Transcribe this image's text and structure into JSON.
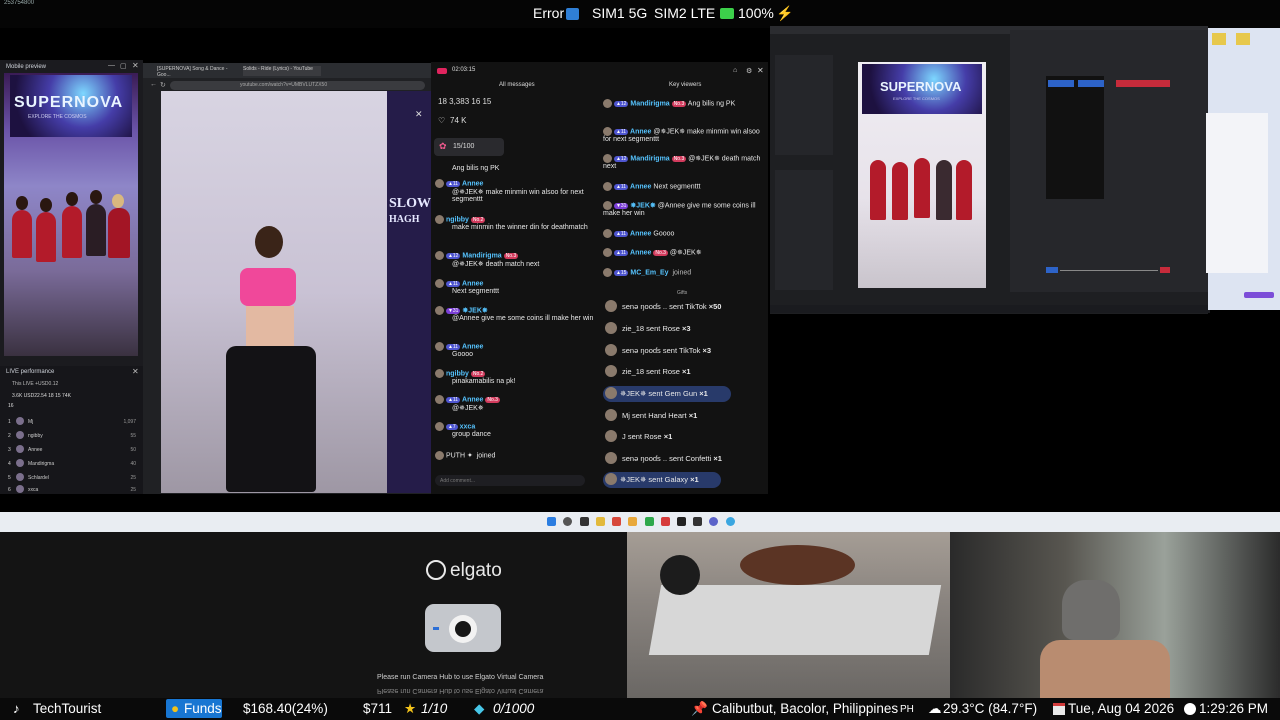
{
  "statusbar": {
    "error": "Error",
    "sim1": "SIM1 5G",
    "sim2": "SIM2 LTE",
    "battery": "100%",
    "corner_id": "253754800"
  },
  "mobile_preview": {
    "title": "Mobile preview",
    "banner_title": "SUPERNOVA",
    "banner_sub": "EXPLORE THE COSMOS"
  },
  "live_performance": {
    "title": "LIVE performance",
    "subtitle": "This LIVE +USD0.12",
    "stats": "3.6K  USD22.54  18  15  74K",
    "count": "16",
    "rows": [
      {
        "rank": "1",
        "name": "Mj",
        "score": "1,097"
      },
      {
        "rank": "2",
        "name": "ngibby",
        "score": "55"
      },
      {
        "rank": "3",
        "name": "Annee",
        "score": "50"
      },
      {
        "rank": "4",
        "name": "Mandirigma",
        "score": "40"
      },
      {
        "rank": "5",
        "name": "Schlardel",
        "score": "25"
      },
      {
        "rank": "6",
        "name": "xxca",
        "score": "25"
      }
    ]
  },
  "browser": {
    "tab1": "[SUPERNOVA] Song & Dance - Goo...",
    "tab2": "Solids - Ride (Lyrics) - YouTube",
    "url": "youtube.com/watch?v=UMBVLUTZX50",
    "strip_text_1": "SLOW",
    "strip_text_2": "HAGH"
  },
  "chat": {
    "timer": "02:03:15",
    "all_messages": "All messages",
    "key_viewers": "Key viewers",
    "stats": "18   3,383   16   15",
    "likes": "74 K",
    "goal": "15/100",
    "messages": [
      {
        "name": "",
        "text": "Ang bilis ng PK"
      },
      {
        "name": "Annee",
        "text": "@✵JEK✵ make minmin win alsoo for next segmenttt"
      },
      {
        "name": "ngibby",
        "text": "make minmin the winner din for deathmatch"
      },
      {
        "name": "Mandirigma",
        "text": "@✵JEK✵ death match next"
      },
      {
        "name": "Annee",
        "text": "Next segmenttt"
      },
      {
        "name": "✵JEK✵",
        "text": "@Annee give me some coins ill make her win"
      },
      {
        "name": "Annee",
        "text": "Goooo"
      },
      {
        "name": "ngibby",
        "text": "pinakamabilis na pk!"
      },
      {
        "name": "Annee",
        "text": "@✵JEK✵"
      },
      {
        "name": "xxca",
        "text": "group dance"
      },
      {
        "name": "PUTH",
        "text": "joined"
      }
    ],
    "input_placeholder": "Add comment...",
    "key_messages": [
      {
        "name": "Mandirigma",
        "text": "Ang bilis ng PK"
      },
      {
        "name": "Annee",
        "text": "@✵JEK✵ make minmin win alsoo for next segmenttt"
      },
      {
        "name": "Mandirigma",
        "text": "@✵JEK✵ death match next"
      },
      {
        "name": "Annee",
        "text": "Next segmenttt"
      },
      {
        "name": "✵JEK✵",
        "text": "@Annee give me some coins ill make her win"
      },
      {
        "name": "Annee",
        "text": "Goooo"
      },
      {
        "name": "Annee",
        "text": "@✵JEK✵"
      },
      {
        "name": "MC_Em_Ey",
        "text": "joined"
      }
    ],
    "gifts_label": "Gifts",
    "gifts": [
      {
        "text": "senə ŋooɗs .. sent TikTok",
        "count": "×50"
      },
      {
        "text": "zie_18 sent Rose",
        "count": "×3"
      },
      {
        "text": "senə ŋooɗs sent TikTok",
        "count": "×3"
      },
      {
        "text": "zie_18 sent Rose",
        "count": "×1"
      },
      {
        "text": "✵JEK✵ sent Gem Gun",
        "count": "×1"
      },
      {
        "text": "Mj sent Hand Heart",
        "count": "×1"
      },
      {
        "text": "J sent Rose",
        "count": "×1"
      },
      {
        "text": "senə ŋooɗs .. sent Confetti",
        "count": "×1"
      },
      {
        "text": "✵JEK✵ sent Galaxy",
        "count": "×1"
      }
    ]
  },
  "obs": {
    "banner": "SUPERNOVA",
    "banner_sub": "EXPLORE THE COSMOS"
  },
  "elgato": {
    "logo": "elgato",
    "message": "Please run Camera Hub to use Elgato Virtual Camera",
    "message_mirror": "Please run Camera Hub to use Elgato Virtual Camera"
  },
  "ticker": {
    "channel": "TechTourist",
    "funds_label": "Funds",
    "funds_value": "$168.40(24%)",
    "amount": "$711",
    "stars": "1/10",
    "gems": "0/1000",
    "location": "Calibutbut, Bacolor, Philippines",
    "country": "PH",
    "weather": "29.3°C (84.7°F)",
    "date": "Tue, Aug 04 2026",
    "time": "1:29:26 PM"
  },
  "colors": {
    "accent_blue": "#1876d2",
    "chat_name": "#56c4ff",
    "battery": "#3cd04a"
  }
}
